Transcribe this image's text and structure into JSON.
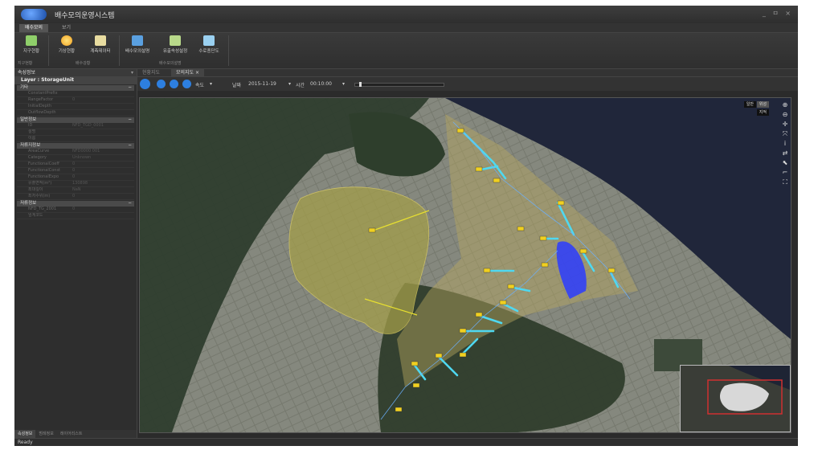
{
  "app": {
    "title": "배수모의운영시스템",
    "window_controls": "_ ㅁ ×"
  },
  "ribbon_tabs": [
    {
      "label": "배수모의",
      "active": true
    },
    {
      "label": "보기",
      "active": false
    }
  ],
  "ribbon": {
    "buttons": [
      {
        "label": "지구현황",
        "icon": "district-icon",
        "color": "#8fcf6a"
      },
      {
        "label": "기상현황",
        "icon": "weather-icon",
        "color": "#f2c94c"
      },
      {
        "label": "계측데이터",
        "icon": "document-icon",
        "color": "#e8dca0"
      },
      {
        "label": "배수모의설명",
        "icon": "simulation-icon",
        "color": "#5aa0e0"
      },
      {
        "label": "유출속성설정",
        "icon": "settings-list-icon",
        "color": "#b8d98a"
      },
      {
        "label": "수로종단도",
        "icon": "profile-chart-icon",
        "color": "#9ad0f0"
      }
    ],
    "groups": [
      "지구현황",
      "배수강황",
      "배수모의설명"
    ]
  },
  "left_panel": {
    "header": "속성정보",
    "pin": "▾",
    "layer_title": "Layer : StorageUnit",
    "sections": [
      {
        "title": "기타",
        "rows": [
          {
            "key": "ConstantPrefix",
            "value": ""
          },
          {
            "key": "RangeFactor",
            "value": "0"
          },
          {
            "key": "InitialDepth",
            "value": ""
          },
          {
            "key": "OutflowDepth",
            "value": ""
          }
        ]
      },
      {
        "title": "일반정보",
        "rows": [
          {
            "key": "ID",
            "value": "NFD_TGD_0001"
          },
          {
            "key": "설명",
            "value": ""
          },
          {
            "key": "이름",
            "value": ""
          }
        ]
      },
      {
        "title": "저류지정보",
        "rows": [
          {
            "key": "AreaCurve",
            "value": "NFD0000 001"
          },
          {
            "key": "Category",
            "value": "Unknown"
          },
          {
            "key": "FunctionalCoeff",
            "value": "0"
          },
          {
            "key": "FunctionalConst",
            "value": "0"
          },
          {
            "key": "FunctionalExpo",
            "value": "0"
          },
          {
            "key": "유출면적(m²)",
            "value": "130898"
          },
          {
            "key": "최대깊이",
            "value": "NaN"
          },
          {
            "key": "최저수위(m)",
            "value": "0"
          }
        ]
      },
      {
        "title": "저류정보",
        "rows": [
          {
            "key": "NFD_TG_2001",
            "value": "0"
          },
          {
            "key": "임계코드",
            "value": ""
          }
        ]
      }
    ],
    "bottom_tabs": [
      {
        "label": "속성정보",
        "active": true
      },
      {
        "label": "범례정보",
        "active": false
      },
      {
        "label": "레이어리스트",
        "active": false
      }
    ]
  },
  "doc_tabs": [
    {
      "label": "현황지도",
      "active": false
    },
    {
      "label": "모의지도",
      "active": true,
      "close": "×"
    }
  ],
  "toolbar": {
    "speed_label": "속도",
    "date_label": "날짜",
    "date_value": "2015-11-19",
    "time_label": "시간",
    "time_value": "00:10:00",
    "progress": 0.05
  },
  "map": {
    "base_buttons": [
      {
        "label": "일반",
        "active": false
      },
      {
        "label": "위성",
        "active": true
      },
      {
        "label": "지적",
        "active": false
      }
    ],
    "tools": [
      "zoom-in-icon",
      "zoom-out-icon",
      "pan-icon",
      "full-extent-icon",
      "info-icon",
      "refresh-icon",
      "select-icon",
      "measure-icon",
      "extent-icon"
    ],
    "tool_glyphs": [
      "⊕",
      "⊖",
      "✛",
      "⤧",
      "i",
      "⇄",
      "⬉",
      "⌐",
      "⛶"
    ]
  },
  "status": "Ready",
  "colors": {
    "accent": "#2d7fe0",
    "catchment": "#8a8a3a",
    "pipe": "#4fd8f0",
    "storage": "#2c3cff",
    "node": "#f0d020"
  }
}
